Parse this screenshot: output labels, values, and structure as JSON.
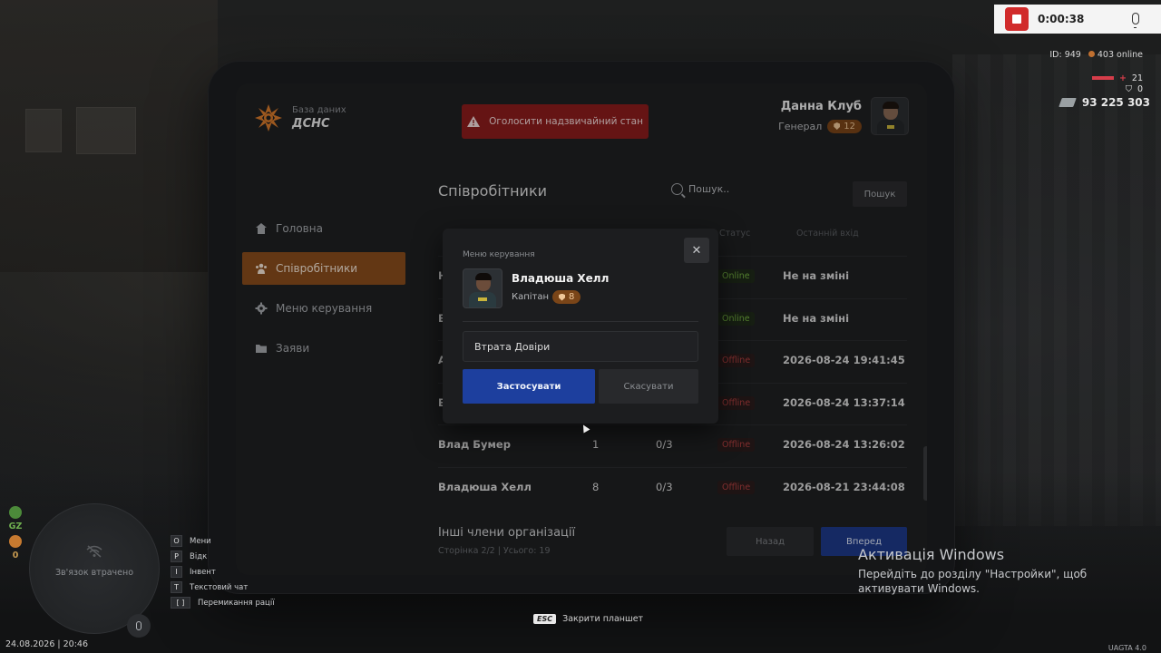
{
  "tablet": {
    "logo": {
      "top": "База даних",
      "bottom": "ДСНС"
    },
    "alert_button": "Оголосити надзвичайний стан",
    "user": {
      "name": "Данна Клуб",
      "rank": "Генерал",
      "badge": "12"
    },
    "nav": [
      {
        "label": "Головна",
        "icon": "home-icon"
      },
      {
        "label": "Співробітники",
        "icon": "users-icon",
        "active": true
      },
      {
        "label": "Меню керування",
        "icon": "gear-icon"
      },
      {
        "label": "Заяви",
        "icon": "folder-icon"
      }
    ],
    "page_title": "Співробітники",
    "search_placeholder": "Пошук..",
    "search_button": "Пошук",
    "columns": {
      "status": "Статус",
      "last": "Останній вхід"
    },
    "rows": [
      {
        "name": "Н",
        "rank": "",
        "warn": "",
        "status": "Online",
        "last": "Не на зміні"
      },
      {
        "name": "В",
        "rank": "",
        "warn": "",
        "status": "Online",
        "last": "Не на зміні"
      },
      {
        "name": "А",
        "rank": "",
        "warn": "",
        "status": "Offline",
        "last": "2026-08-24 19:41:45"
      },
      {
        "name": "В",
        "rank": "",
        "warn": "",
        "status": "Offline",
        "last": "2026-08-24 13:37:14"
      },
      {
        "name": "Влад Бумер",
        "rank": "1",
        "warn": "0/3",
        "status": "Offline",
        "last": "2026-08-24 13:26:02"
      },
      {
        "name": "Владюша Хелл",
        "rank": "8",
        "warn": "0/3",
        "status": "Offline",
        "last": "2026-08-21 23:44:08"
      }
    ],
    "footer_title": "Інші члени організації",
    "footer_sub": "Сторінка 2/2 | Усього: 19",
    "back_button": "Назад",
    "next_button": "Вперед"
  },
  "modal": {
    "title": "Меню керування",
    "close": "✕",
    "name": "Владюша Хелл",
    "rank": "Капітан",
    "badge": "8",
    "select_value": "Втрата Довіри",
    "apply": "Застосувати",
    "cancel": "Скасувати"
  },
  "hud": {
    "rec_time": "0:00:38",
    "id": "ID: 949",
    "online": "403 online",
    "health": "21",
    "armor": "0",
    "money": "93 225 303",
    "minimap_text": "Зв'язок втрачено",
    "gz_label": "GZ",
    "gz_count": "0",
    "keys": [
      {
        "key": "O",
        "label": "Мени"
      },
      {
        "key": "P",
        "label": "Відк"
      },
      {
        "key": "I",
        "label": "Інвент"
      },
      {
        "key": "T",
        "label": "Текстовий чат"
      },
      {
        "key": "[ ]",
        "label": "Перемикання рації"
      }
    ],
    "date": "24.08.2026 | 20:46",
    "esc_key": "ESC",
    "esc_label": "Закрити планшет",
    "watermark_title": "Активація Windows",
    "watermark_body": "Перейдіть до розділу \"Настройки\", щоб активувати Windows.",
    "version": "UAGTA 4.0"
  },
  "colors": {
    "accent": "#8a4d1c",
    "primary": "#1d3f9e",
    "danger": "#8c1d1d",
    "online": "#74b042",
    "offline": "#b34040"
  }
}
